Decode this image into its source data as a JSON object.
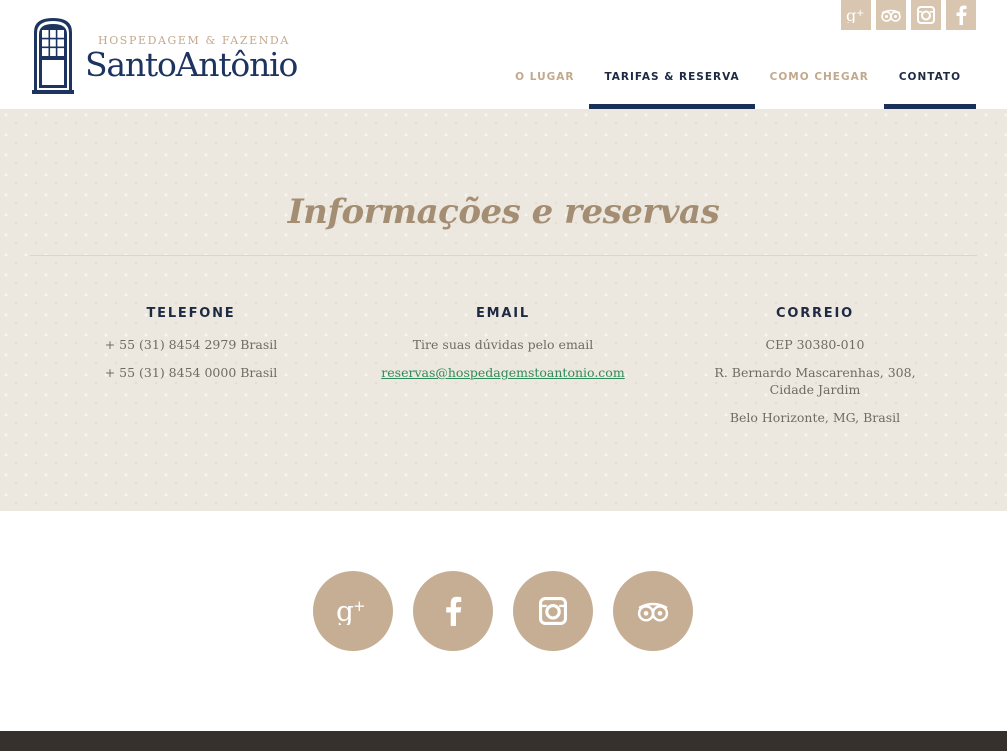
{
  "brand": {
    "subtitle": "HOSPEDAGEM & FAZENDA",
    "name": "SantoAntônio"
  },
  "social_top": [
    "google-plus-icon",
    "tripadvisor-icon",
    "instagram-icon",
    "facebook-icon"
  ],
  "nav": {
    "items": [
      {
        "label": "O LUGAR",
        "active": false
      },
      {
        "label": "TARIFAS & RESERVA",
        "active": true
      },
      {
        "label": "COMO CHEGAR",
        "active": false
      },
      {
        "label": "CONTATO",
        "active": true
      }
    ]
  },
  "contact": {
    "title": "Informações e reservas",
    "telefone": {
      "heading": "TELEFONE",
      "lines": [
        "+ 55 (31) 8454 2979 Brasil",
        "+ 55 (31) 8454 0000 Brasil"
      ]
    },
    "email": {
      "heading": "EMAIL",
      "text": "Tire suas dúvidas pelo email",
      "address": "reservas@hospedagemstoantonio.com"
    },
    "correio": {
      "heading": "CORREIO",
      "cep": "CEP 30380-010",
      "street": "R. Bernardo Mascarenhas, 308, Cidade Jardim",
      "city": "Belo Horizonte, MG, Brasil"
    }
  },
  "social_circles": [
    "google-plus-icon",
    "facebook-icon",
    "instagram-icon",
    "tripadvisor-icon"
  ],
  "colors": {
    "navy": "#1d3460",
    "tan": "#c5ae93",
    "beige_bg": "#ede8df",
    "link_green": "#2e8a5a",
    "footer": "#36312c"
  }
}
